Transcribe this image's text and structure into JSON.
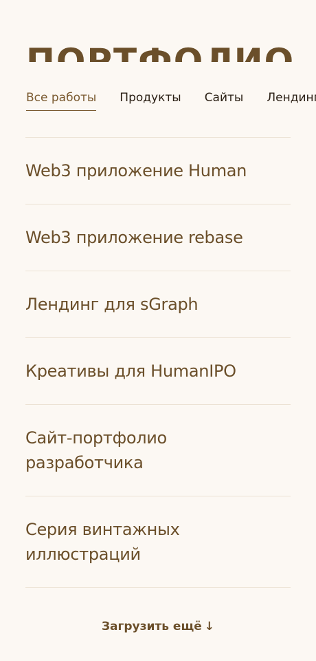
{
  "header": {
    "title": "ПОРТФОЛИО"
  },
  "tabs": [
    {
      "label": "Все работы",
      "active": true
    },
    {
      "label": "Продукты",
      "active": false
    },
    {
      "label": "Сайты",
      "active": false
    },
    {
      "label": "Лендинги",
      "active": false
    }
  ],
  "works": [
    {
      "title": "Web3 приложение Human"
    },
    {
      "title": "Web3 приложение rebase"
    },
    {
      "title": "Лендинг для sGraph"
    },
    {
      "title": "Креативы для HumanIPO"
    },
    {
      "title": "Сайт-портфолио разработчика"
    },
    {
      "title": "Серия винтажных иллюстраций"
    }
  ],
  "load_more": {
    "label": "Загрузить ещё",
    "icon": "arrow-down-icon",
    "glyph": "↓"
  },
  "colors": {
    "background": "#fcf8f3",
    "accent": "#6b4f2a",
    "divider": "#ece2d4"
  }
}
